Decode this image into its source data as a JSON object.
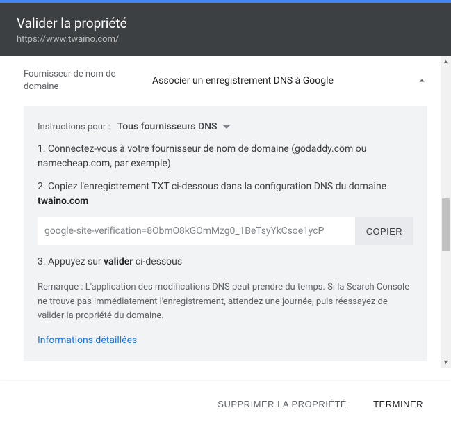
{
  "header": {
    "title": "Valider la propriété",
    "subtitle": "https://www.twaino.com/"
  },
  "provider": {
    "label": "Fournisseur de nom de domaine",
    "value": "Associer un enregistrement DNS à Google"
  },
  "instructions": {
    "prefix": "Instructions pour :",
    "selector": "Tous fournisseurs DNS",
    "step1": "1. Connectez-vous à votre fournisseur de nom de domaine (godaddy.com ou namecheap.com, par exemple)",
    "step2_pre": "2. Copiez l'enregistrement TXT ci-dessous dans la configuration DNS du domaine ",
    "step2_bold": "twaino.com",
    "txt_record": "google-site-verification=8ObmO8kGOmMzg0_1BeTsyYkCsoe1ycP",
    "copy_label": "COPIER",
    "step3_pre": "3. Appuyez sur ",
    "step3_bold": "valider",
    "step3_post": " ci-dessous",
    "remark": "Remarque : L'application des modifications DNS peut prendre du temps. Si la Search Console ne trouve pas immédiatement l'enregistrement, attendez une journée, puis réessayez de valider la propriété du domaine.",
    "details_link": "Informations détaillées"
  },
  "footer": {
    "delete_label": "SUPPRIMER LA PROPRIÉTÉ",
    "done_label": "TERMINER"
  }
}
